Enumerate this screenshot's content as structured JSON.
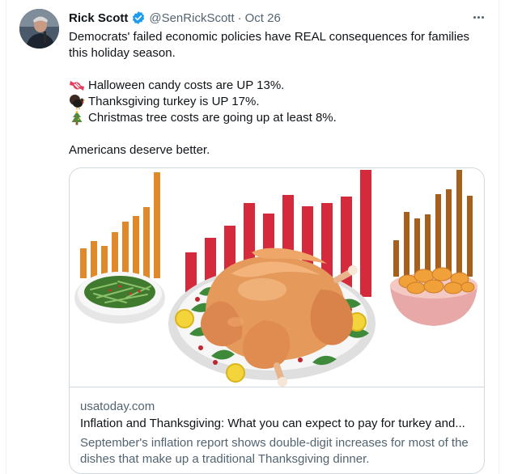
{
  "author": {
    "name": "Rick Scott",
    "handle": "@SenRickScott",
    "separator": "·",
    "date": "Oct 26"
  },
  "tweet": {
    "line1": "Democrats' failed economic policies have REAL consequences for families",
    "line2": "this holiday season.",
    "items": [
      {
        "icon": "candy-icon",
        "text": "Halloween candy costs are UP 13%."
      },
      {
        "icon": "turkey-icon",
        "text": "Thanksgiving turkey is UP 17%."
      },
      {
        "icon": "christmas-tree-icon",
        "text": "Christmas tree costs are going up at least 8%."
      }
    ],
    "closing": "Americans deserve better."
  },
  "card": {
    "domain": "usatoday.com",
    "title": "Inflation and Thanksgiving: What you can expect to pay for turkey and...",
    "description": "September's inflation report shows double-digit increases for most of the dishes that make up a traditional Thanksgiving dinner."
  },
  "colors": {
    "link_blue": "#1d9bf0",
    "secondary_text": "#536471",
    "orange_bars": "#e0892b",
    "red_bars": "#d42a3c",
    "brown_bars": "#a5601d"
  }
}
